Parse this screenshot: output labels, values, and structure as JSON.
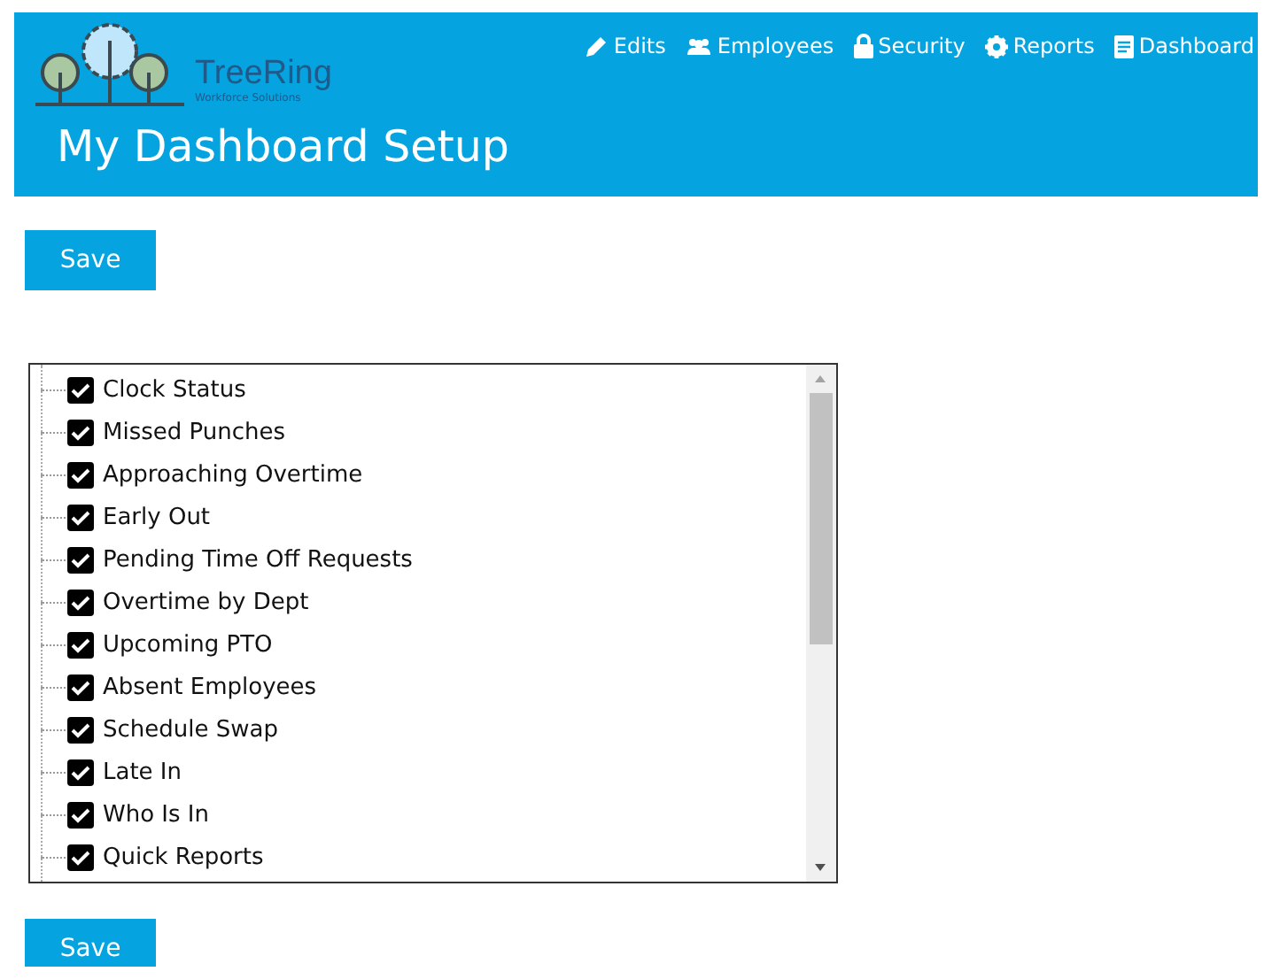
{
  "header": {
    "logo_name": "TreeRing",
    "logo_tagline": "Workforce Solutions",
    "title": "My Dashboard Setup",
    "nav": [
      {
        "label": "Edits",
        "kind": "pencil"
      },
      {
        "label": "Employees",
        "kind": "people"
      },
      {
        "label": "Security",
        "kind": "lock"
      },
      {
        "label": "Reports",
        "kind": "gear"
      },
      {
        "label": "Dashboard",
        "kind": "document"
      }
    ]
  },
  "save_top": "Save",
  "widgets": [
    {
      "label": "Clock Status",
      "checked": true
    },
    {
      "label": "Missed Punches",
      "checked": true
    },
    {
      "label": "Approaching Overtime",
      "checked": true
    },
    {
      "label": "Early Out",
      "checked": true
    },
    {
      "label": "Pending Time Off Requests",
      "checked": true
    },
    {
      "label": "Overtime by Dept",
      "checked": true
    },
    {
      "label": "Upcoming PTO",
      "checked": true
    },
    {
      "label": "Absent Employees",
      "checked": true
    },
    {
      "label": "Schedule Swap",
      "checked": true
    },
    {
      "label": "Late In",
      "checked": true
    },
    {
      "label": "Who Is In",
      "checked": true
    },
    {
      "label": "Quick Reports",
      "checked": true
    }
  ],
  "save_bottom": "Save"
}
